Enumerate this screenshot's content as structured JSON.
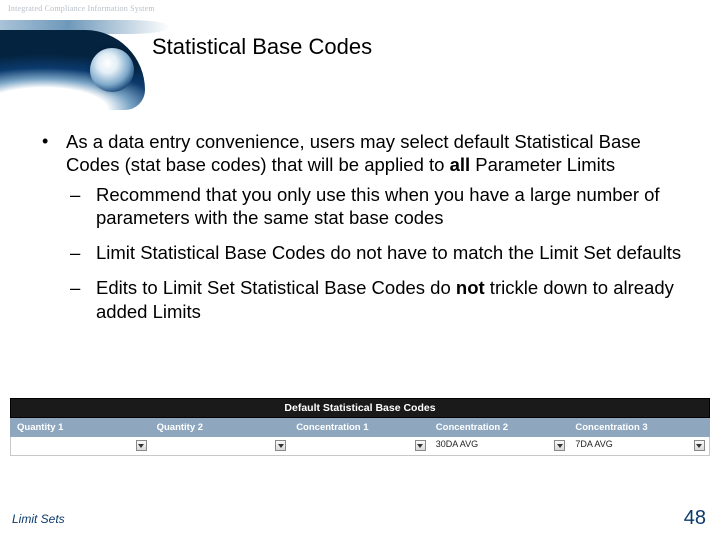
{
  "header": {
    "system_label": "Integrated Compliance Information System",
    "title": "Statistical Base Codes"
  },
  "body": {
    "bullet1_part1": "As a data entry convenience, users may select default Statistical Base Codes  (stat base codes) that will be applied to ",
    "bullet1_bold": "all",
    "bullet1_part2": " Parameter Limits",
    "sub1": "Recommend that you only use this when you have a large number of parameters with the same stat base codes",
    "sub2": "Limit Statistical Base Codes do not have to match the Limit Set defaults",
    "sub3_part1": "Edits to Limit Set Statistical Base Codes do ",
    "sub3_bold": "not",
    "sub3_part2": " trickle down to already added Limits"
  },
  "table": {
    "title": "Default Statistical Base Codes",
    "cols": {
      "c1": "Quantity 1",
      "c2": "Quantity 2",
      "c3": "Concentration 1",
      "c4": "Concentration 2",
      "c5": "Concentration 3"
    },
    "vals": {
      "c1": "",
      "c2": "",
      "c3": "",
      "c4": "30DA AVG",
      "c5": "7DA AVG"
    }
  },
  "footer": {
    "section": "Limit Sets",
    "page": "48"
  }
}
